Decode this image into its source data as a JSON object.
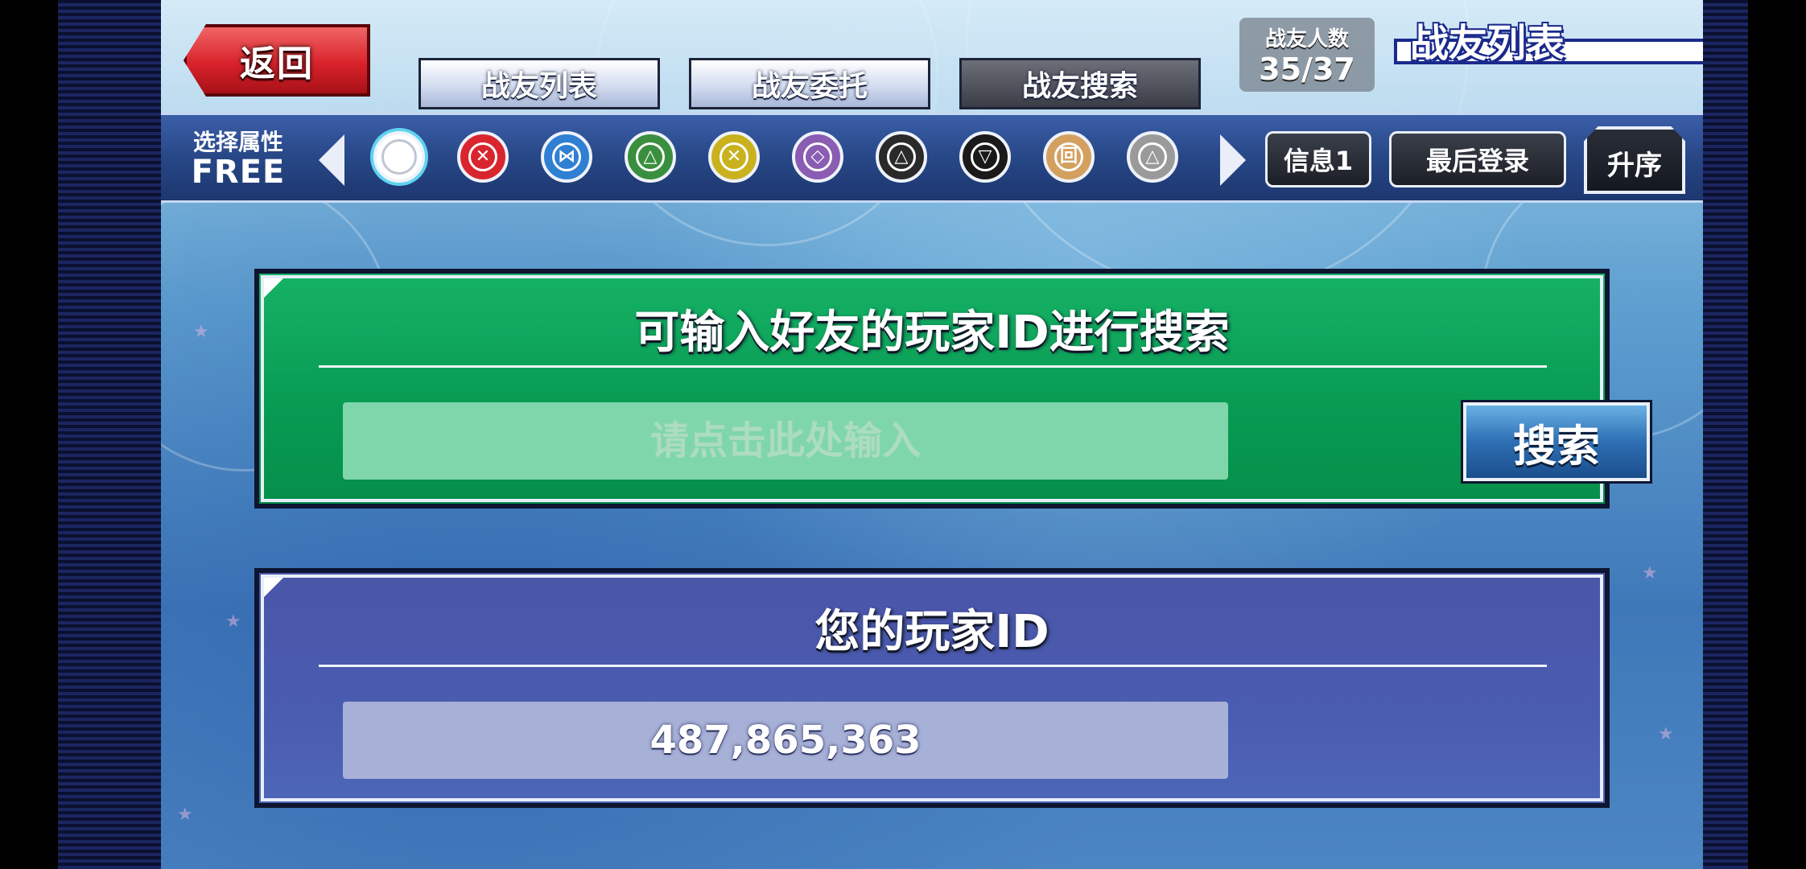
{
  "header": {
    "back_label": "返回",
    "tabs": [
      {
        "label": "战友列表"
      },
      {
        "label": "战友委托"
      },
      {
        "label": "战友搜索"
      }
    ],
    "count_label": "战友人数",
    "count_value": "35/37",
    "page_title": "战友列表"
  },
  "filter": {
    "label": "选择属性",
    "value": "FREE",
    "attributes": [
      {
        "name": "all",
        "color": "#ffffff",
        "glyph": ""
      },
      {
        "name": "red",
        "color": "#d9262e",
        "glyph": "✕"
      },
      {
        "name": "blue",
        "color": "#2f7fd2",
        "glyph": "⋈"
      },
      {
        "name": "green",
        "color": "#3a8f3e",
        "glyph": "△"
      },
      {
        "name": "yellow",
        "color": "#c9b21e",
        "glyph": "✕"
      },
      {
        "name": "purple",
        "color": "#8a5cb2",
        "glyph": "◇"
      },
      {
        "name": "black",
        "color": "#2a2a2a",
        "glyph": "△"
      },
      {
        "name": "dark",
        "color": "#1a1a1a",
        "glyph": "▽"
      },
      {
        "name": "orange",
        "color": "#d4a060",
        "glyph": "回"
      },
      {
        "name": "gray",
        "color": "#9a9a9a",
        "glyph": "△"
      }
    ],
    "info_label": "信息1",
    "last_login_label": "最后登录",
    "sort_label": "升序"
  },
  "search_panel": {
    "title": "可输入好友的玩家ID进行搜索",
    "placeholder": "请点击此处输入",
    "search_label": "搜索"
  },
  "id_panel": {
    "title": "您的玩家ID",
    "player_id": "487,865,363"
  }
}
